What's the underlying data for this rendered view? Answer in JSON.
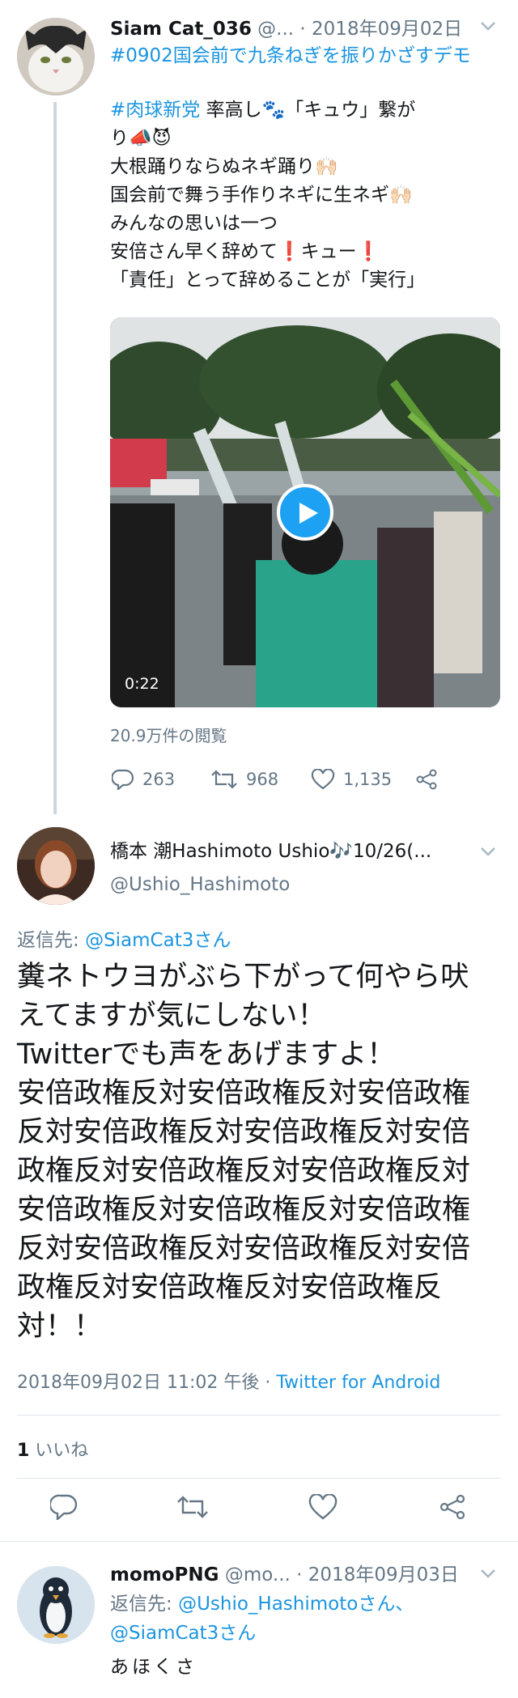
{
  "tweet1": {
    "name": "Siam Cat_036",
    "handle": "@...",
    "date": " · 2018年09月02日",
    "hashtag_line": "#0902国会前で九条ねぎを振りかざすデモ",
    "text_lines": [
      {
        "tag": "#肉球新党",
        "rest": " 率高し🐾「キュウ」繋が"
      },
      {
        "tag": "",
        "rest": "り📣😈"
      },
      {
        "tag": "",
        "rest": "大根踊りならぬネギ踊り🙌🏻"
      },
      {
        "tag": "",
        "rest": "国会前で舞う手作りネギに生ネギ🙌🏻"
      },
      {
        "tag": "",
        "rest": "みんなの思いは一つ"
      },
      {
        "tag": "",
        "rest": "安倍さん早く辞めて❗キュー❗"
      },
      {
        "tag": "",
        "rest": "「責任」とって辞めることが「実行」"
      }
    ],
    "video_duration": "0:22",
    "views": "20.9万件の閲覧",
    "replies": "263",
    "retweets": "968",
    "likes": "1,135"
  },
  "tweet2": {
    "name": "橋本 潮Hashimoto Ushio🎶10/26(...",
    "handle": "@Ushio_Hashimoto",
    "reply_to_label": "返信先: ",
    "reply_to": "@SiamCat3さん",
    "text_lines": [
      "糞ネトウヨがぶら下がって何やら吠",
      "えてますが気にしない！",
      "Twitterでも声をあげますよ！",
      "安倍政権反対安倍政権反対安倍政権",
      "反対安倍政権反対安倍政権反対安倍",
      "政権反対安倍政権反対安倍政権反対",
      "安倍政権反対安倍政権反対安倍政権",
      "反対安倍政権反対安倍政権反対安倍",
      "政権反対安倍政権反対安倍政権反",
      "対！！"
    ],
    "timestamp": "2018年09月02日 11:02 午後 · ",
    "client": "Twitter for Android",
    "likes_count": "1",
    "likes_label": " いいね"
  },
  "tweet3": {
    "name": "momoPNG",
    "handle": "@mo...",
    "date": " · 2018年09月03日",
    "reply_to_label": "返信先: ",
    "reply_to_1": "@Ushio_Hashimotoさん、",
    "reply_to_2": "@SiamCat3さん",
    "text": "あほくさ"
  },
  "icons": [
    "reply-icon",
    "retweet-icon",
    "like-icon",
    "share-icon",
    "chevron-down-icon",
    "play-icon"
  ],
  "colors": {
    "link": "#1b95e0",
    "meta": "#657786",
    "play": "#1da1f2"
  }
}
